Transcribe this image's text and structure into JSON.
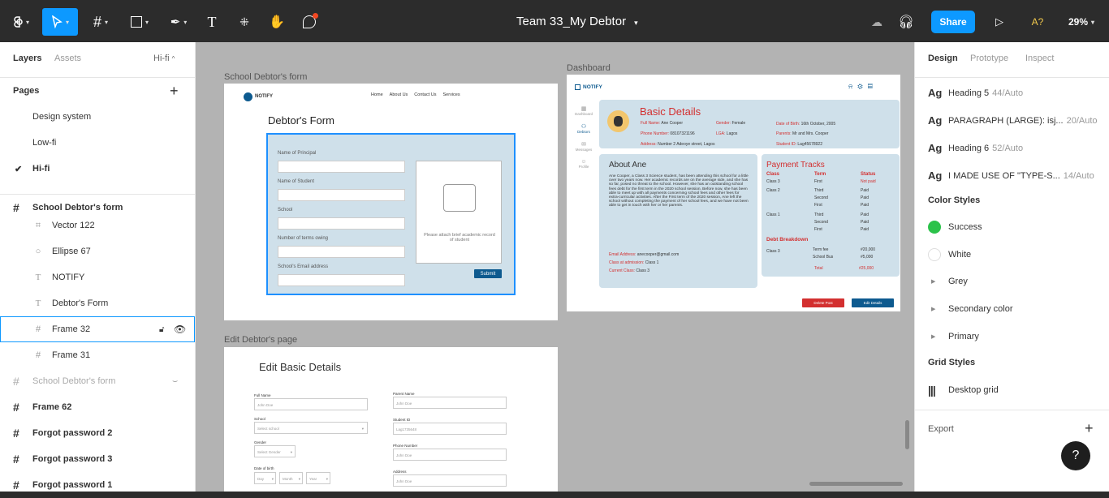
{
  "toolbar": {
    "title": "Team 33_My Debtor",
    "share": "Share",
    "zoom": "29%",
    "font_status": "A?"
  },
  "left": {
    "tabs": {
      "layers": "Layers",
      "assets": "Assets",
      "page": "Hi-fi"
    },
    "pages_header": "Pages",
    "pages": [
      "Design system",
      "Low-fi",
      "Hi-fi"
    ],
    "layers": [
      {
        "name": "School Debtor's form"
      },
      {
        "name": "Vector 122"
      },
      {
        "name": "Ellipse 67"
      },
      {
        "name": "NOTIFY"
      },
      {
        "name": "Debtor's Form"
      },
      {
        "name": "Frame 32"
      },
      {
        "name": "Frame 31"
      },
      {
        "name": "School Debtor's form"
      },
      {
        "name": "Frame 62"
      },
      {
        "name": "Forgot password 2"
      },
      {
        "name": "Forgot password 3"
      },
      {
        "name": "Forgot password 1"
      }
    ]
  },
  "canvas": {
    "frame1": {
      "label": "School Debtor's form",
      "logo": "NOTIFY",
      "nav": [
        "Home",
        "About Us",
        "Contact Us",
        "Services"
      ],
      "heading": "Debtor's Form",
      "fields": [
        "Name of Principal",
        "Name of Student",
        "School",
        "Number of terms owing",
        "School's Email address"
      ],
      "attach": "Please attach brief academic record of student",
      "submit": "Submit"
    },
    "frame2": {
      "label": "Dashboard",
      "logo": "NOTIFY",
      "side": [
        "Dashboard",
        "Debtors",
        "Messages",
        "Profile"
      ],
      "basic_title": "Basic Details",
      "basic": [
        {
          "k": "Full Name:",
          "v": "Ane Cooper"
        },
        {
          "k": "Gender:",
          "v": "Female"
        },
        {
          "k": "Date of Birth:",
          "v": "16th October, 2005"
        },
        {
          "k": "Phone Number:",
          "v": "08107321196"
        },
        {
          "k": "LGA:",
          "v": "Lagos"
        },
        {
          "k": "Parents:",
          "v": "Mr and Mrs. Cooper"
        },
        {
          "k": "Address:",
          "v": "Number 2 Adeoye street, Lagos"
        },
        {
          "k": "Student ID:",
          "v": "Lag45678922"
        }
      ],
      "about_title": "About Ane",
      "about_text": "Ane Cooper, a Class 3 Science student, has been attending this school for a little over two years now. Her academic records are on the average side, and she has so far, posed no threat to the school. However, she has an outstanding school fees debt for the first term in the 2020 school session. Before now, she has been able to meet up with all payments concerning school fees and other fees for extra-curricular activities. After the First term of the 2020 session, Ane left the school without completing the payment of her school fees, and we have not been able to get in touch with her or her parents.",
      "email_k": "Email Address:",
      "email_v": "anecooper@gmail.com",
      "admission_k": "Class at admission:",
      "admission_v": "Class 1",
      "current_k": "Current Class:",
      "current_v": "Class 3",
      "pay_title": "Payment Tracks",
      "pay_headers": [
        "Class",
        "Term",
        "Status"
      ],
      "pay_rows": [
        {
          "c": "Class 3",
          "t": "First",
          "s": "Not paid"
        },
        {
          "c": "Class 2",
          "t": "Third",
          "s": "Paid"
        },
        {
          "c": "",
          "t": "Second",
          "s": "Paid"
        },
        {
          "c": "",
          "t": "First",
          "s": "Paid"
        },
        {
          "c": "Class 1",
          "t": "Third",
          "s": "Paid"
        },
        {
          "c": "",
          "t": "Second",
          "s": "Paid"
        },
        {
          "c": "",
          "t": "First",
          "s": "Paid"
        }
      ],
      "debt_title": "Debt Breakdown",
      "debt_class": "Class 3",
      "debt_rows": [
        {
          "k": "Term fee",
          "v": "#20,000"
        },
        {
          "k": "School Bus",
          "v": "#5,000"
        }
      ],
      "total_k": "Total",
      "total_v": "#25,000",
      "delete": "Delete Post",
      "edit": "Edit Details"
    },
    "frame3": {
      "label": "Edit Debtor's page",
      "heading": "Edit Basic Details",
      "full_name": "Full Name",
      "full_name_ph": "John Doe",
      "school": "School",
      "school_ph": "Select school",
      "gender": "Gender",
      "gender_ph": "Select Gender",
      "dob": "Date of birth",
      "day": "Day",
      "month": "Month",
      "year": "Year",
      "parent": "Parent Name",
      "parent_ph": "John Doe",
      "sid": "Student ID",
      "sid_ph": "Lag1735648",
      "phone": "Phone Number",
      "phone_ph": "John Doe",
      "address": "Address",
      "address_ph": "John Doe"
    }
  },
  "right": {
    "tabs": [
      "Design",
      "Prototype",
      "Inspect"
    ],
    "text_styles": [
      {
        "name": "Heading 5",
        "meta": "44/Auto"
      },
      {
        "name": "PARAGRAPH (LARGE): isj...",
        "meta": "20/Auto"
      },
      {
        "name": "Heading 6",
        "meta": "52/Auto"
      },
      {
        "name": "I MADE USE OF \"TYPE-S...",
        "meta": "14/Auto"
      }
    ],
    "color_styles_header": "Color Styles",
    "colors": [
      {
        "name": "Success",
        "color": "#2bc24a"
      },
      {
        "name": "White",
        "color": "#ffffff"
      }
    ],
    "color_groups": [
      "Grey",
      "Secondary color",
      "Primary"
    ],
    "grid_header": "Grid Styles",
    "grid": "Desktop grid",
    "export": "Export"
  }
}
